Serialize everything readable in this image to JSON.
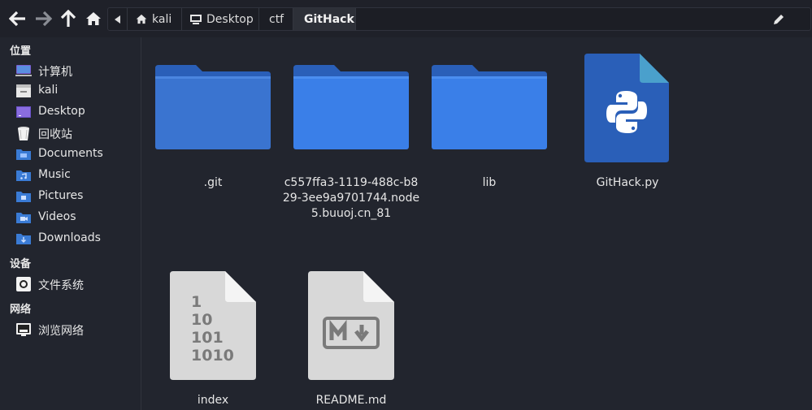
{
  "toolbar": {
    "breadcrumbs": [
      "kali",
      "Desktop",
      "ctf",
      "GitHack"
    ]
  },
  "sidebar": {
    "places_header": "位置",
    "places": [
      {
        "label": "计算机",
        "icon": "computer-icon"
      },
      {
        "label": "kali",
        "icon": "home-folder-icon"
      },
      {
        "label": "Desktop",
        "icon": "desktop-folder-icon"
      },
      {
        "label": "回收站",
        "icon": "trash-icon"
      },
      {
        "label": "Documents",
        "icon": "documents-folder-icon"
      },
      {
        "label": "Music",
        "icon": "music-folder-icon"
      },
      {
        "label": "Pictures",
        "icon": "pictures-folder-icon"
      },
      {
        "label": "Videos",
        "icon": "videos-folder-icon"
      },
      {
        "label": "Downloads",
        "icon": "downloads-folder-icon"
      }
    ],
    "devices_header": "设备",
    "devices": [
      {
        "label": "文件系统",
        "icon": "drive-icon"
      }
    ],
    "network_header": "网络",
    "network": [
      {
        "label": "浏览网络",
        "icon": "network-icon"
      }
    ]
  },
  "files": [
    {
      "name": ".git",
      "type": "folder"
    },
    {
      "name": "c557ffa3-1119-488c-b829-3ee9a9701744.node5.buuoj.cn_81",
      "type": "folder"
    },
    {
      "name": "lib",
      "type": "folder"
    },
    {
      "name": "GitHack.py",
      "type": "python"
    },
    {
      "name": "index",
      "type": "binary"
    },
    {
      "name": "README.md",
      "type": "markdown"
    }
  ],
  "colors": {
    "folder": "#3a7bd5",
    "folder_back": "#2a5fb8",
    "python_doc": "#2a5fb8",
    "fold_corner": "#4aa0cc",
    "doc_grey": "#d8d8d8"
  }
}
